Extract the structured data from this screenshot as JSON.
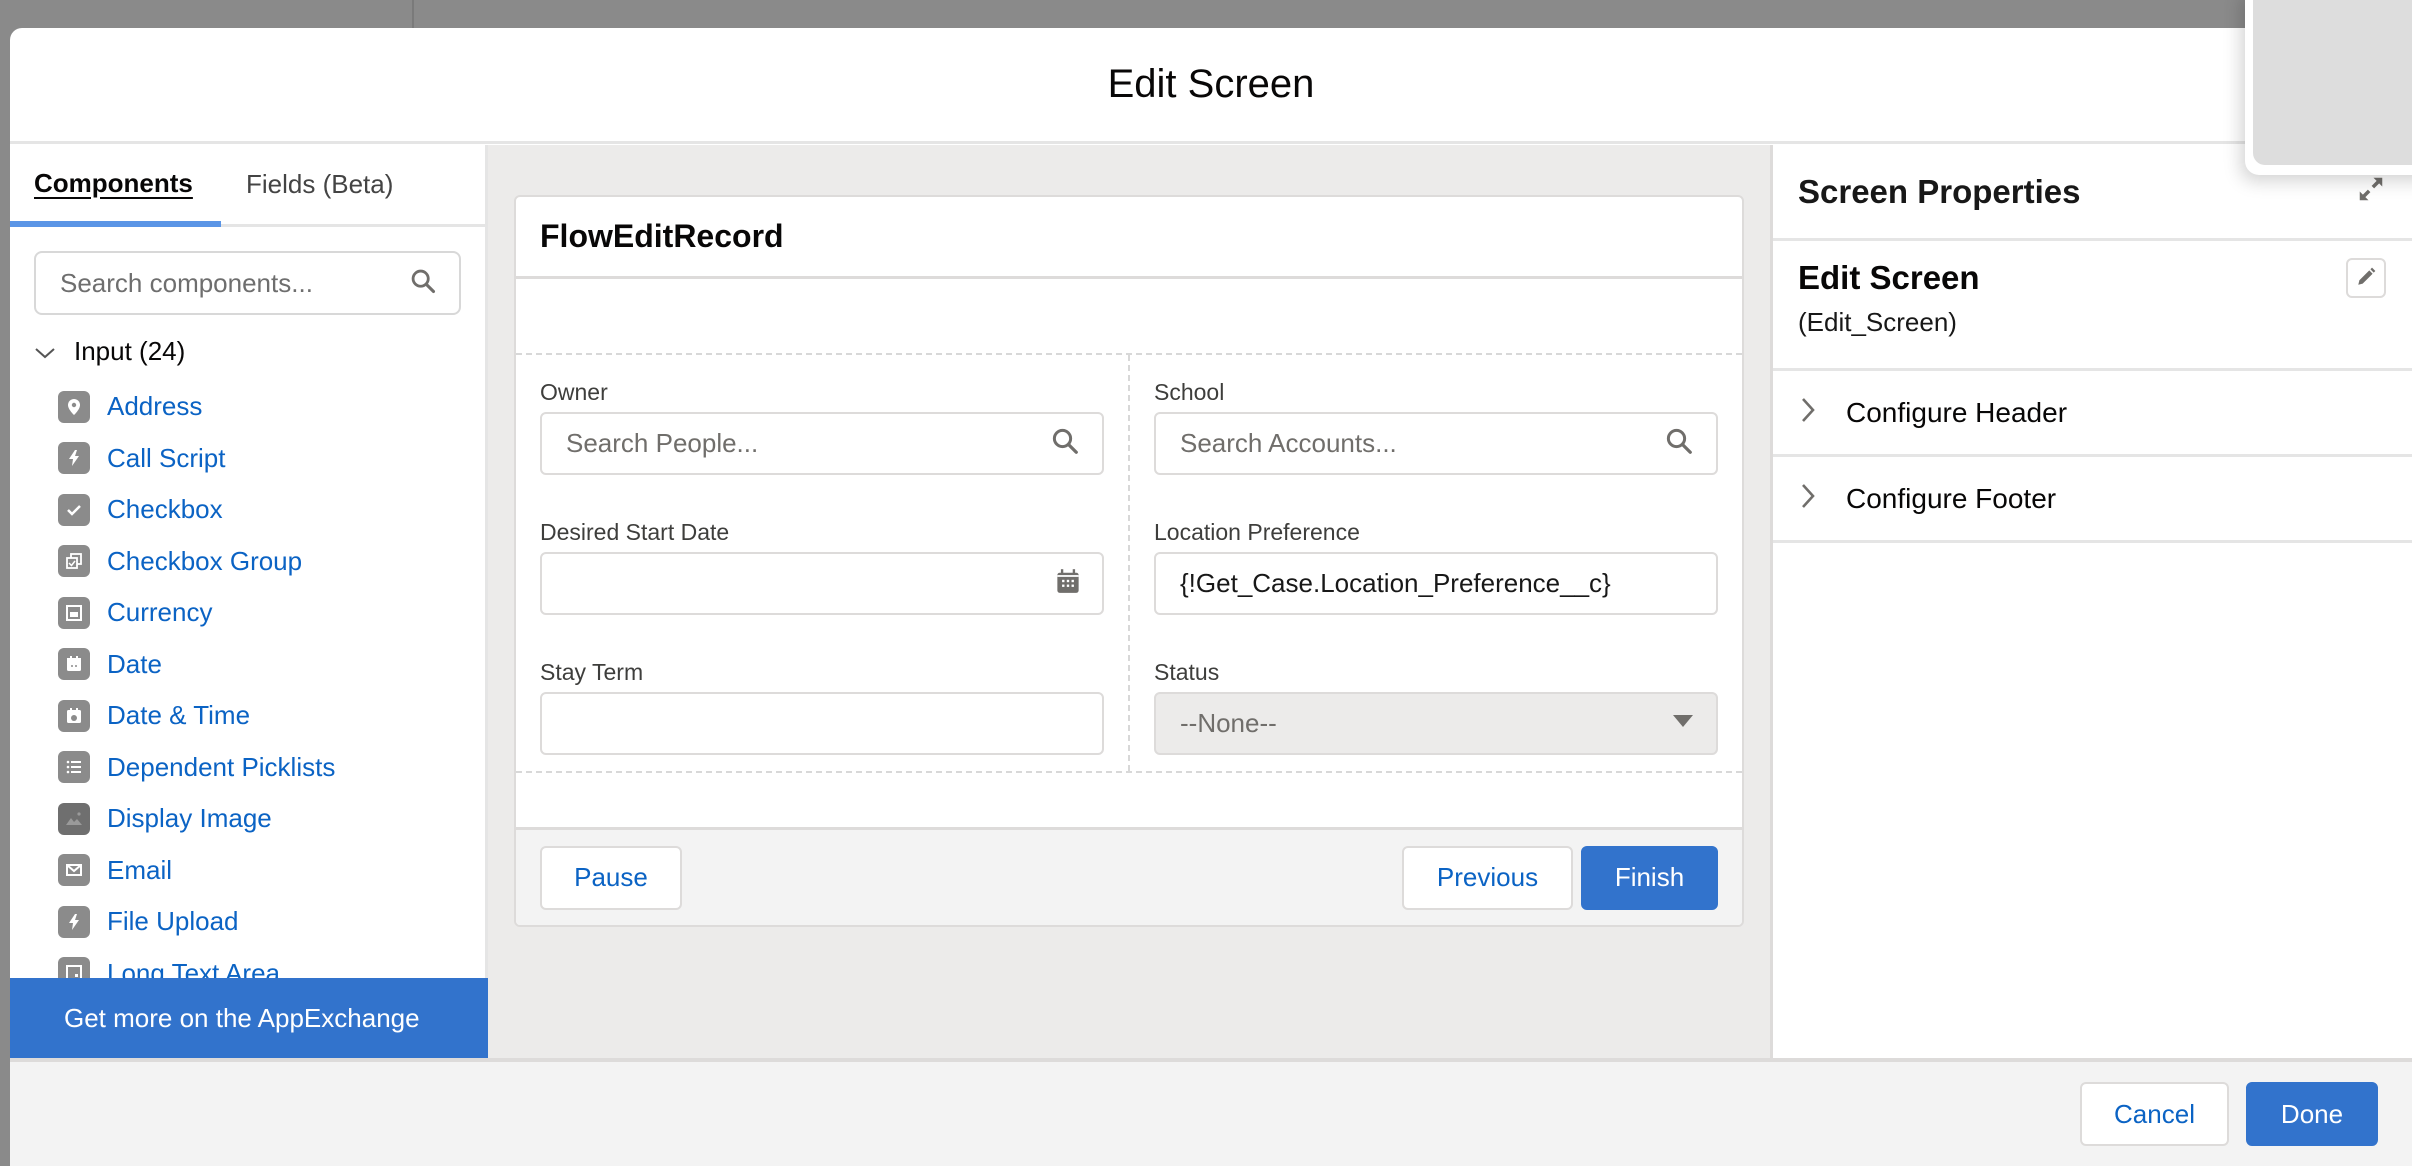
{
  "modal": {
    "title": "Edit Screen"
  },
  "left_panel": {
    "tabs": [
      {
        "label": "Components",
        "active": true
      },
      {
        "label": "Fields (Beta)",
        "active": false
      }
    ],
    "search": {
      "placeholder": "Search components...",
      "value": ""
    },
    "section": {
      "label": "Input (24)",
      "expanded": true
    },
    "components": [
      {
        "label": "Address",
        "icon": "location-pin-icon"
      },
      {
        "label": "Call Script",
        "icon": "lightning-icon"
      },
      {
        "label": "Checkbox",
        "icon": "checkbox-check-icon"
      },
      {
        "label": "Checkbox Group",
        "icon": "checkbox-group-icon"
      },
      {
        "label": "Currency",
        "icon": "currency-icon"
      },
      {
        "label": "Date",
        "icon": "calendar-icon"
      },
      {
        "label": "Date & Time",
        "icon": "calendar-clock-icon"
      },
      {
        "label": "Dependent Picklists",
        "icon": "list-icon"
      },
      {
        "label": "Display Image",
        "icon": "image-icon"
      },
      {
        "label": "Email",
        "icon": "email-icon"
      },
      {
        "label": "File Upload",
        "icon": "lightning-icon"
      },
      {
        "label": "Long Text Area",
        "icon": "text-area-icon"
      }
    ],
    "appexchange_label": "Get more on the AppExchange"
  },
  "canvas": {
    "card_title": "FlowEditRecord",
    "fields_left": [
      {
        "label": "Owner",
        "type": "lookup",
        "placeholder": "Search People...",
        "value": "",
        "icon": "search-icon"
      },
      {
        "label": "Desired Start Date",
        "type": "date",
        "placeholder": "",
        "value": "",
        "icon": "calendar-icon"
      },
      {
        "label": "Stay Term",
        "type": "text",
        "placeholder": "",
        "value": ""
      }
    ],
    "fields_right": [
      {
        "label": "School",
        "type": "lookup",
        "placeholder": "Search Accounts...",
        "value": "",
        "icon": "search-icon"
      },
      {
        "label": "Location Preference",
        "type": "text",
        "placeholder": "",
        "value": "{!Get_Case.Location_Preference__c}"
      },
      {
        "label": "Status",
        "type": "picklist",
        "selected": "--None--",
        "disabled": true
      }
    ],
    "footer": {
      "pause_label": "Pause",
      "previous_label": "Previous",
      "finish_label": "Finish"
    }
  },
  "right_panel": {
    "title": "Screen Properties",
    "screen_name": "Edit Screen",
    "screen_api_name": "(Edit_Screen)",
    "accordions": [
      {
        "label": "Configure Header",
        "expanded": false
      },
      {
        "label": "Configure Footer",
        "expanded": false
      }
    ]
  },
  "footer": {
    "cancel_label": "Cancel",
    "done_label": "Done"
  },
  "colors": {
    "brand": "#3273cc",
    "link": "#0b63c4",
    "tab_indicator": "#5a95e6",
    "canvas_bg": "#ecebea",
    "backdrop": "#8a8a8a"
  }
}
